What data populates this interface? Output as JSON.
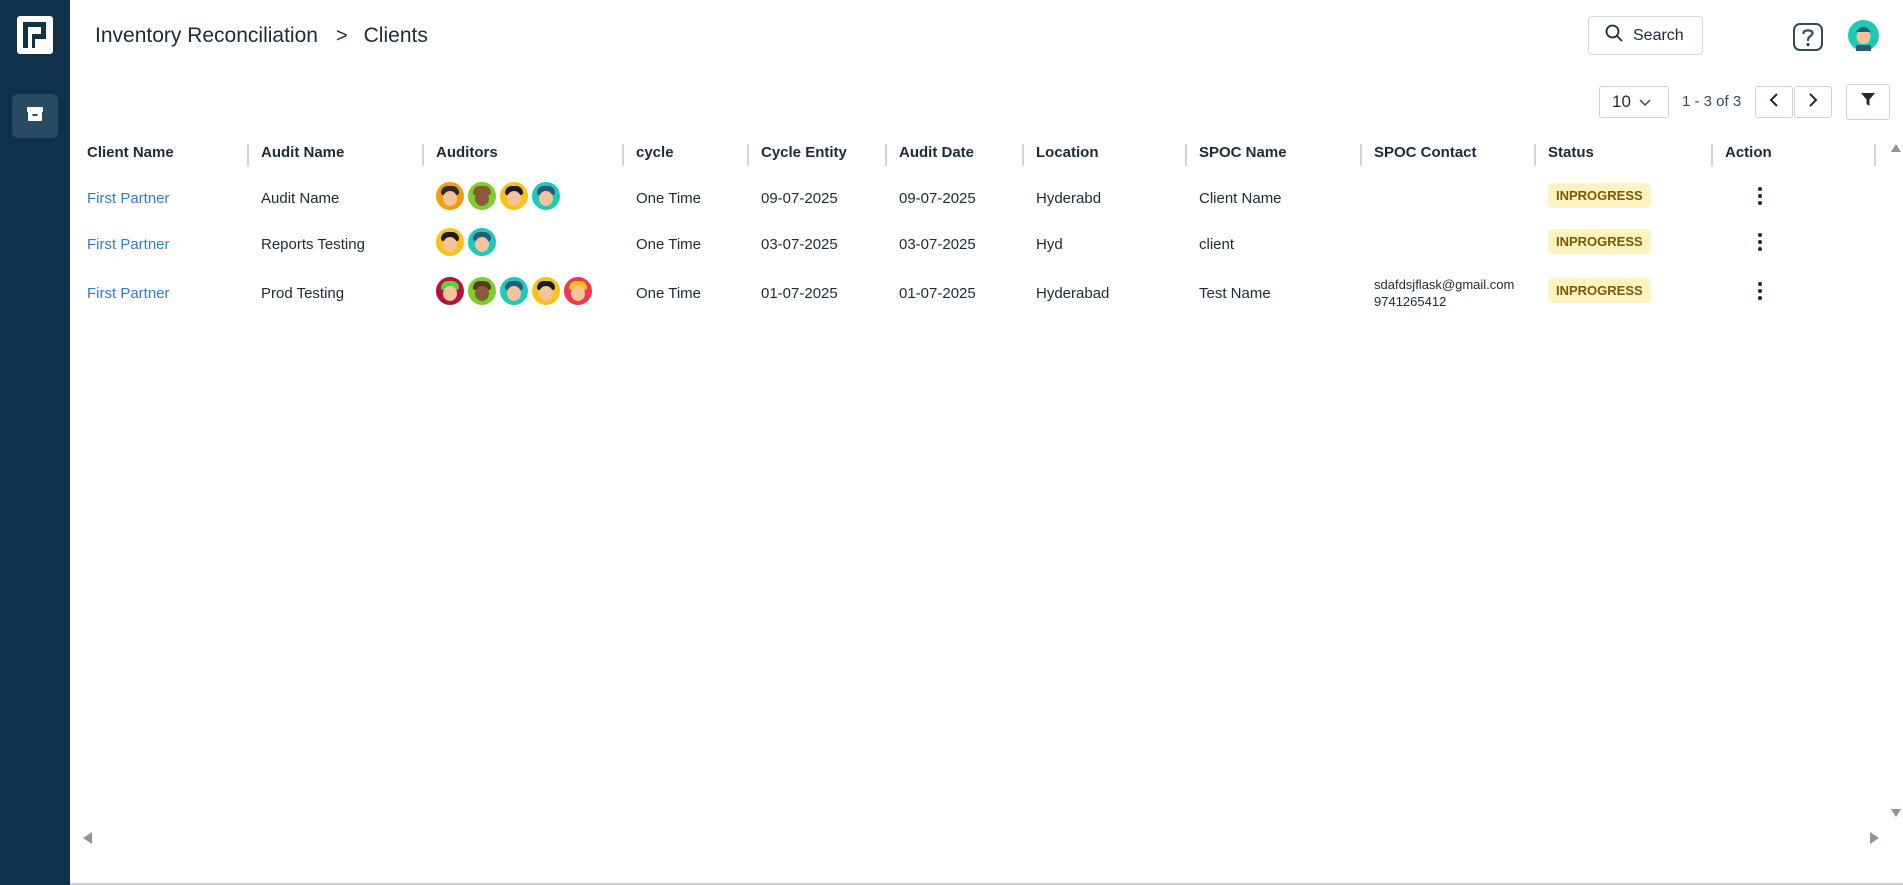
{
  "breadcrumb": {
    "parent": "Inventory Reconciliation",
    "separator": ">",
    "current": "Clients"
  },
  "header": {
    "search_label": "Search"
  },
  "pagination": {
    "page_size": "10",
    "range": "1 - 3 of 3"
  },
  "table": {
    "columns": [
      "Client Name",
      "Audit Name",
      "Auditors",
      "cycle",
      "Cycle Entity",
      "Audit Date",
      "Location",
      "SPOC Name",
      "SPOC Contact",
      "Status",
      "Action"
    ],
    "rows": [
      {
        "client_name": "First Partner",
        "audit_name": "Audit Name",
        "auditors": [
          "#f39c12",
          "#7ccd2e",
          "#f7c21b",
          "#1dc9b7"
        ],
        "cycle": "One Time",
        "cycle_entity": "09-07-2025",
        "audit_date": "09-07-2025",
        "location": "Hyderabd",
        "spoc_name": "Client Name",
        "spoc_email": "",
        "spoc_phone": "",
        "status": "INPROGRESS"
      },
      {
        "client_name": "First Partner",
        "audit_name": "Reports Testing",
        "auditors": [
          "#f7c21b",
          "#1dc9b7"
        ],
        "cycle": "One Time",
        "cycle_entity": "03-07-2025",
        "audit_date": "03-07-2025",
        "location": "Hyd",
        "spoc_name": "client",
        "spoc_email": "",
        "spoc_phone": "",
        "status": "INPROGRESS"
      },
      {
        "client_name": "First Partner",
        "audit_name": "Prod Testing",
        "auditors": [
          "#b0153f",
          "#7ccd2e",
          "#1dc9b7",
          "#f7c21b",
          "#f0375a"
        ],
        "cycle": "One Time",
        "cycle_entity": "01-07-2025",
        "audit_date": "01-07-2025",
        "location": "Hyderabad",
        "spoc_name": "Test Name",
        "spoc_email": "sdafdsjflask@gmail.com",
        "spoc_phone": "9741265412",
        "status": "INPROGRESS"
      }
    ]
  },
  "colors": {
    "sidebar": "#11314a",
    "link": "#2b7fd1",
    "badge_bg": "#fdf3c0",
    "badge_text": "#7a5b00"
  }
}
